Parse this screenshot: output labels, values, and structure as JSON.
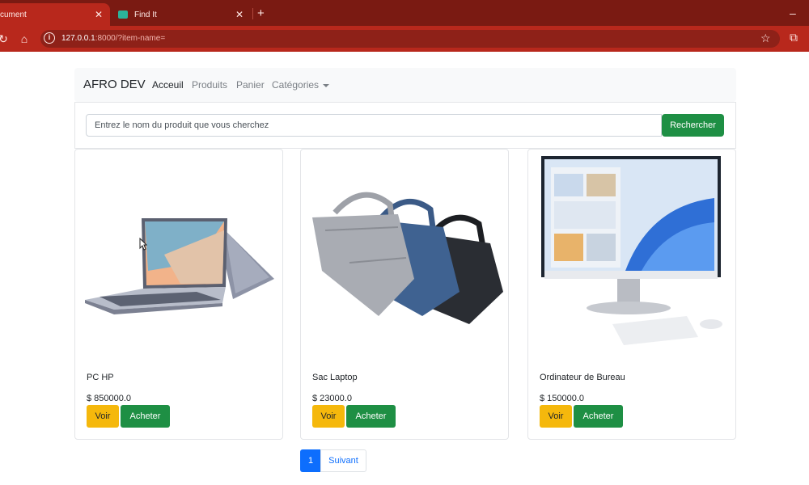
{
  "browser": {
    "tabs": [
      {
        "title": "cument",
        "active": true
      },
      {
        "title": "Find It",
        "active": false
      }
    ],
    "url_host": "127.0.0.1",
    "url_rest": ":8000/?item-name=",
    "accent_color": "#b8281c"
  },
  "navbar": {
    "brand": "AFRO DEV",
    "links": [
      "Acceuil",
      "Produits",
      "Panier",
      "Catégories"
    ]
  },
  "search": {
    "placeholder": "Entrez le nom du produit que vous cherchez",
    "button": "Rechercher"
  },
  "products": [
    {
      "name": "PC HP",
      "price": "$ 850000.0",
      "voir": "Voir",
      "acheter": "Acheter"
    },
    {
      "name": "Sac Laptop",
      "price": "$ 23000.0",
      "voir": "Voir",
      "acheter": "Acheter"
    },
    {
      "name": "Ordinateur de Bureau",
      "price": "$ 150000.0",
      "voir": "Voir",
      "acheter": "Acheter"
    }
  ],
  "pagination": {
    "current": "1",
    "next": "Suivant"
  }
}
